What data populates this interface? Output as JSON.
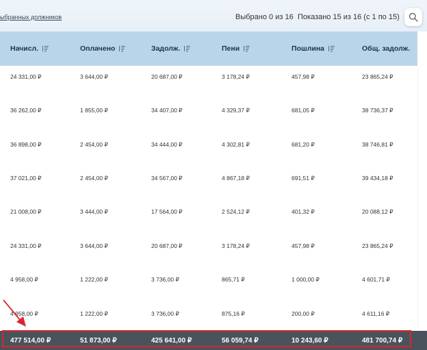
{
  "toolbar": {
    "filter_link": "ыбранных должников",
    "selected_info": "Выбрано 0 из 16",
    "shown_info": "Показано 15 из 16 (с 1 по 15)"
  },
  "icons": {
    "search": "search-icon",
    "sort": "sort-icon",
    "annotation": "red-arrow"
  },
  "colors": {
    "header_bg": "#b9d5ea",
    "total_bg": "#4a535c",
    "highlight": "#d9262e"
  },
  "table": {
    "columns": [
      "Начисл.",
      "Оплачено",
      "Задолж.",
      "Пени",
      "Пошлина",
      "Общ. задолж."
    ],
    "rows": [
      [
        "24 331,00 ₽",
        "3 644,00 ₽",
        "20 687,00 ₽",
        "3 178,24 ₽",
        "457,98 ₽",
        "23 865,24 ₽"
      ],
      [
        "36 262,00 ₽",
        "1 855,00 ₽",
        "34 407,00 ₽",
        "4 329,37 ₽",
        "681,05 ₽",
        "38 736,37 ₽"
      ],
      [
        "36 898,00 ₽",
        "2 454,00 ₽",
        "34 444,00 ₽",
        "4 302,81 ₽",
        "681,20 ₽",
        "38 746,81 ₽"
      ],
      [
        "37 021,00 ₽",
        "2 454,00 ₽",
        "34 567,00 ₽",
        "4 867,18 ₽",
        "691,51 ₽",
        "39 434,18 ₽"
      ],
      [
        "21 008,00 ₽",
        "3 444,00 ₽",
        "17 564,00 ₽",
        "2 524,12 ₽",
        "401,32 ₽",
        "20 088,12 ₽"
      ],
      [
        "24 331,00 ₽",
        "3 644,00 ₽",
        "20 687,00 ₽",
        "3 178,24 ₽",
        "457,98 ₽",
        "23 865,24 ₽"
      ],
      [
        "4 958,00 ₽",
        "1 222,00 ₽",
        "3 736,00 ₽",
        "865,71 ₽",
        "1 000,00 ₽",
        "4 601,71 ₽"
      ],
      [
        "4 958,00 ₽",
        "1 222,00 ₽",
        "3 736,00 ₽",
        "875,16 ₽",
        "200,00 ₽",
        "4 611,16 ₽"
      ]
    ],
    "totals": [
      "477 514,00 ₽",
      "51 873,00 ₽",
      "425 641,00 ₽",
      "56 059,74 ₽",
      "10 243,60 ₽",
      "481 700,74 ₽"
    ]
  }
}
